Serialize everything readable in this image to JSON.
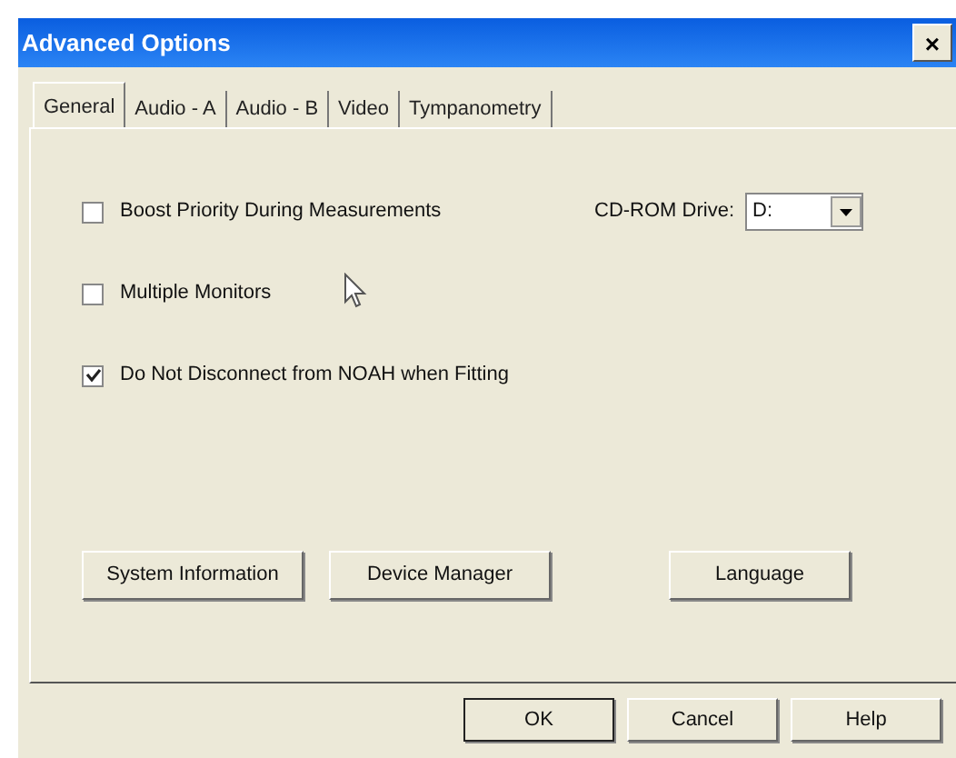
{
  "window": {
    "title": "Advanced Options",
    "close": "×"
  },
  "tabs": [
    {
      "label": "General",
      "selected": true
    },
    {
      "label": "Audio - A",
      "selected": false
    },
    {
      "label": "Audio - B",
      "selected": false
    },
    {
      "label": "Video",
      "selected": false
    },
    {
      "label": "Tympanometry",
      "selected": false
    }
  ],
  "options": [
    {
      "label": "Boost Priority During Measurements",
      "checked": false
    },
    {
      "label": "Multiple Monitors",
      "checked": false
    },
    {
      "label": "Do Not Disconnect from NOAH when Fitting",
      "checked": true
    }
  ],
  "cdrom": {
    "label": "CD-ROM Drive:",
    "value": "D:"
  },
  "panel_buttons": [
    "System Information",
    "Device Manager",
    "Language"
  ],
  "dialog_buttons": [
    {
      "label": "OK",
      "default": true
    },
    {
      "label": "Cancel",
      "default": false
    },
    {
      "label": "Help",
      "default": false
    }
  ]
}
